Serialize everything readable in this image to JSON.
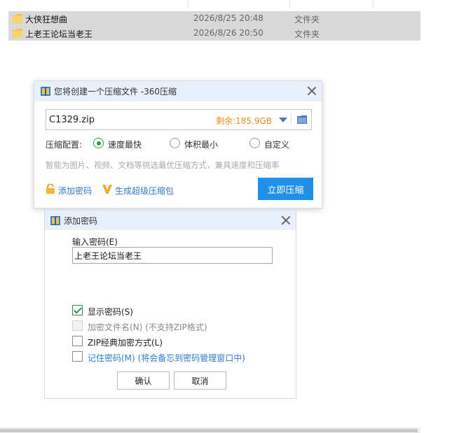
{
  "explorer": {
    "files": [
      {
        "name": "大侠狂想曲",
        "date": "2026/8/25 20:48",
        "type": "文件夹"
      },
      {
        "name": "上老王论坛当老王",
        "date": "2026/8/26 20:50",
        "type": "文件夹"
      }
    ]
  },
  "compress_dialog": {
    "title": "您将创建一个压缩文件 -360压缩",
    "filename": "C1329.zip",
    "free_space": "剩余:185.9GB",
    "config_label": "压缩配置:",
    "options": [
      {
        "label": "速度最快",
        "checked": true
      },
      {
        "label": "体积最小",
        "checked": false
      },
      {
        "label": "自定义",
        "checked": false
      }
    ],
    "hint": "智能为图片、视频、文档等挑选最优压缩方式，兼具速度和压缩率",
    "add_password_link": "添加密码",
    "super_link": "生成超级压缩包",
    "compress_button": "立即压缩"
  },
  "password_dialog": {
    "title": "添加密码",
    "input_label": "输入密码(E)",
    "input_value": "上老王论坛当老王",
    "checks": {
      "show_password": {
        "label": "显示密码(S)",
        "checked": true
      },
      "encrypt_filenames": {
        "label": "加密文件名(N) (不支持ZIP格式)",
        "disabled": true
      },
      "zip_classic": {
        "label": "ZIP经典加密方式(L)",
        "checked": false
      },
      "remember": {
        "label": "记住密码(M) (将会备忘到密码管理窗口中)",
        "checked": false
      }
    },
    "ok_button": "确认",
    "cancel_button": "取消"
  },
  "colors": {
    "accent": "#1f8fe8",
    "free_space": "#ef8b1c",
    "link": "#2f7bd1",
    "radio_checked": "#27a04b",
    "titlebar": "#e8f1fb"
  }
}
